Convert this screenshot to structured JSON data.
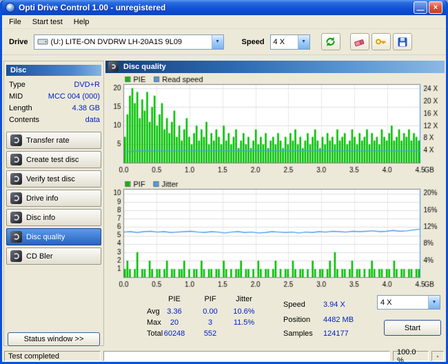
{
  "window": {
    "title": "Opti Drive Control 1.00 - unregistered"
  },
  "menu": {
    "items": [
      "File",
      "Start test",
      "Help"
    ]
  },
  "toolbar": {
    "drive_label": "Drive",
    "drive_value": "(U:)  LITE-ON DVDRW LH-20A1S 9L09",
    "speed_label": "Speed",
    "speed_value": "4 X"
  },
  "sidebar": {
    "header": "Disc",
    "info": [
      {
        "label": "Type",
        "value": "DVD+R"
      },
      {
        "label": "MID",
        "value": "MCC 004 (000)"
      },
      {
        "label": "Length",
        "value": "4.38 GB"
      },
      {
        "label": "Contents",
        "value": "data"
      }
    ],
    "buttons": [
      "Transfer rate",
      "Create test disc",
      "Verify test disc",
      "Drive info",
      "Disc info",
      "Disc quality",
      "CD Bler"
    ],
    "active_button": "Disc quality",
    "status_button": "Status window >>"
  },
  "main": {
    "header": "Disc quality"
  },
  "stats": {
    "columns": [
      "PIE",
      "PIF",
      "Jitter"
    ],
    "rows": [
      {
        "label": "Avg",
        "pie": "3.36",
        "pif": "0.00",
        "jitter": "10.6%"
      },
      {
        "label": "Max",
        "pie": "20",
        "pif": "3",
        "jitter": "11.5%"
      },
      {
        "label": "Total",
        "pie": "60248",
        "pif": "552",
        "jitter": ""
      }
    ],
    "right": [
      {
        "label": "Speed",
        "value": "3.94 X"
      },
      {
        "label": "Position",
        "value": "4482 MB"
      },
      {
        "label": "Samples",
        "value": "124177"
      }
    ],
    "speed_select": "4 X",
    "start_button": "Start"
  },
  "statusbar": {
    "text": "Test completed",
    "percent": "100.0 %"
  },
  "chart_data": [
    {
      "type": "bar",
      "title": "PIE / Read speed",
      "legend": [
        {
          "label": "PIE",
          "color": "#00c000"
        },
        {
          "label": "Read speed",
          "color": "#4a9af0"
        }
      ],
      "x_ticks": [
        "0.0",
        "0.5",
        "1.0",
        "1.5",
        "2.0",
        "2.5",
        "3.0",
        "3.5",
        "4.0",
        "4.5"
      ],
      "x_unit": "GB",
      "x_range_gb": [
        0,
        4.5
      ],
      "left_ticks": [
        5,
        10,
        15,
        20
      ],
      "left_max": 21,
      "right_ticks": [
        "24 X",
        "20 X",
        "16 X",
        "12 X",
        "8 X",
        "4 X"
      ],
      "right_tick_vals": [
        24,
        20,
        16,
        12,
        8,
        4
      ],
      "right_max": 25.5,
      "bar_color": "#00c000",
      "bars": [
        7,
        13,
        18,
        20,
        16,
        19,
        12,
        17,
        14,
        19,
        11,
        15,
        18,
        10,
        13,
        16,
        9,
        12,
        8,
        11,
        14,
        7,
        10,
        6,
        9,
        12,
        7,
        5,
        8,
        10,
        6,
        9,
        7,
        11,
        5,
        8,
        6,
        9,
        7,
        5,
        10,
        6,
        8,
        5,
        7,
        9,
        4,
        6,
        8,
        5,
        7,
        4,
        6,
        9,
        5,
        7,
        5,
        8,
        4,
        6,
        7,
        5,
        8,
        6,
        4,
        7,
        5,
        8,
        6,
        9,
        5,
        7,
        4,
        6,
        8,
        5,
        7,
        9,
        6,
        4,
        7,
        5,
        8,
        6,
        7,
        5,
        9,
        6,
        7,
        8,
        5,
        6,
        9,
        7,
        5,
        8,
        6,
        7,
        9,
        5,
        8,
        6,
        7,
        5,
        9,
        7,
        6,
        8,
        10,
        6,
        7,
        9,
        6,
        8,
        7,
        9,
        6,
        8,
        7,
        6
      ],
      "line": {
        "name": "Read speed",
        "color": "#4a9af0",
        "axis_max": 25.5,
        "values": [
          3.6,
          3.92,
          3.94,
          3.94,
          3.94,
          3.94,
          3.94,
          3.94,
          3.94,
          3.94,
          3.94,
          3.94,
          3.94,
          3.94,
          3.94,
          3.94,
          3.94,
          3.94,
          3.94,
          3.94
        ]
      }
    },
    {
      "type": "bar",
      "title": "PIF / Jitter",
      "legend": [
        {
          "label": "PIF",
          "color": "#00c000"
        },
        {
          "label": "Jitter",
          "color": "#4a9af0"
        }
      ],
      "x_ticks": [
        "0.0",
        "0.5",
        "1.0",
        "1.5",
        "2.0",
        "2.5",
        "3.0",
        "3.5",
        "4.0",
        "4.5"
      ],
      "x_unit": "GB",
      "x_range_gb": [
        0,
        4.5
      ],
      "left_ticks": [
        1,
        2,
        3,
        4,
        5,
        6,
        7,
        8,
        9,
        10
      ],
      "left_max": 10.5,
      "right_ticks": [
        "20%",
        "16%",
        "12%",
        "8%",
        "4%"
      ],
      "right_tick_vals": [
        20,
        16,
        12,
        8,
        4
      ],
      "right_max": 21,
      "bar_color": "#00c000",
      "bars": [
        1,
        2,
        1,
        0,
        1,
        3,
        0,
        1,
        1,
        0,
        2,
        1,
        0,
        1,
        1,
        0,
        1,
        2,
        0,
        1,
        1,
        0,
        1,
        1,
        2,
        0,
        1,
        0,
        1,
        1,
        0,
        2,
        1,
        0,
        1,
        1,
        0,
        1,
        1,
        0,
        2,
        1,
        0,
        1,
        0,
        1,
        1,
        2,
        0,
        1,
        1,
        0,
        1,
        0,
        2,
        1,
        0,
        1,
        1,
        0,
        1,
        2,
        0,
        1,
        0,
        1,
        1,
        0,
        2,
        1,
        0,
        1,
        1,
        0,
        1,
        0,
        2,
        1,
        0,
        1,
        1,
        0,
        1,
        2,
        0,
        3,
        1,
        0,
        1,
        1,
        0,
        1,
        2,
        0,
        1,
        1,
        0,
        1,
        0,
        1,
        2,
        1,
        0,
        1,
        1,
        0,
        1,
        1,
        0,
        2,
        1,
        0,
        1,
        1,
        0,
        1,
        1,
        0,
        1,
        1
      ],
      "line": {
        "name": "Jitter",
        "color": "#4a9af0",
        "axis_max": 21,
        "values": [
          10.8,
          10.9,
          10.7,
          10.9,
          11.0,
          10.8,
          10.9,
          10.7,
          10.8,
          10.9,
          11.0,
          10.8,
          10.7,
          10.9,
          10.8,
          10.6,
          10.8,
          10.9,
          10.7,
          10.8,
          10.6,
          10.7,
          10.9,
          10.8,
          10.7,
          10.8,
          10.6,
          10.8,
          10.7,
          10.9,
          10.8,
          11.0,
          10.9,
          10.8,
          11.0,
          10.9,
          11.0,
          11.1,
          10.9,
          11.0,
          11.2,
          11.0,
          11.1,
          11.3,
          11.5
        ]
      }
    }
  ]
}
